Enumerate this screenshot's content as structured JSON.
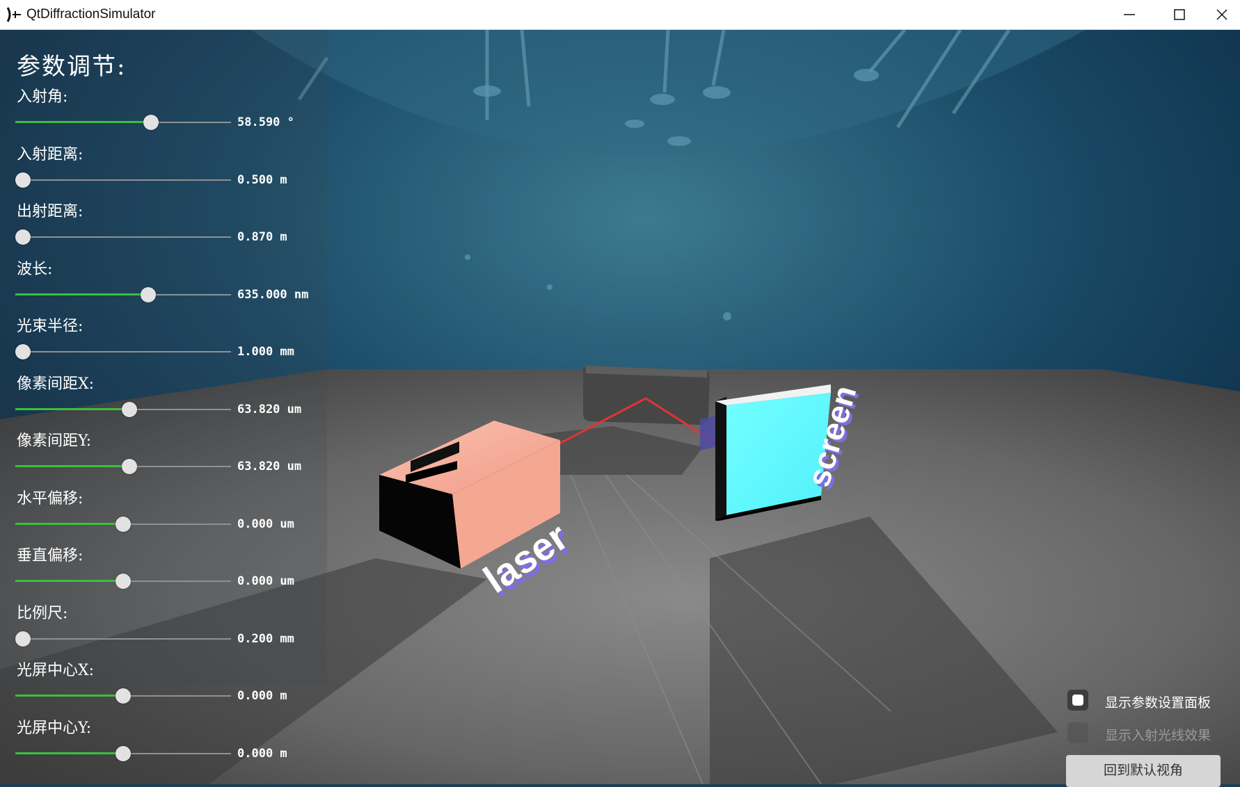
{
  "window": {
    "title": "QtDiffractionSimulator",
    "controls": {
      "minimize": "minimize-icon",
      "maximize": "maximize-icon",
      "close": "close-icon"
    }
  },
  "panel": {
    "title": "参数调节:",
    "params": [
      {
        "label": "入射角:",
        "value": "58.590 °",
        "fraction": 0.64
      },
      {
        "label": "入射距离:",
        "value": "0.500 m",
        "fraction": 0.0
      },
      {
        "label": "出射距离:",
        "value": "0.870 m",
        "fraction": 0.0
      },
      {
        "label": "波长:",
        "value": "635.000 nm",
        "fraction": 0.625
      },
      {
        "label": "光束半径:",
        "value": "1.000 mm",
        "fraction": 0.0
      },
      {
        "label": "像素间距X:",
        "value": "63.820 um",
        "fraction": 0.53
      },
      {
        "label": "像素间距Y:",
        "value": "63.820 um",
        "fraction": 0.53
      },
      {
        "label": "水平偏移:",
        "value": "0.000 um",
        "fraction": 0.5
      },
      {
        "label": "垂直偏移:",
        "value": "0.000 um",
        "fraction": 0.5
      },
      {
        "label": "比例尺:",
        "value": "0.200 mm",
        "fraction": 0.0
      },
      {
        "label": "光屏中心X:",
        "value": "0.000 m",
        "fraction": 0.5
      },
      {
        "label": "光屏中心Y:",
        "value": "0.000 m",
        "fraction": 0.5
      }
    ]
  },
  "scene": {
    "laser_label": "laser",
    "screen_label": "screen",
    "colors": {
      "laser_body": "#f7ac98",
      "screen": "#66fcff",
      "beam": "#e23434",
      "label": "#ffffff",
      "label_side": "#7d6fe0"
    }
  },
  "controls": {
    "show_panel_label": "显示参数设置面板",
    "show_panel_checked": true,
    "show_ray_label": "显示入射光线效果",
    "show_ray_checked": false,
    "reset_view_label": "回到默认视角"
  },
  "colors": {
    "accent": "#3cbf3c",
    "sky": "#103450",
    "floor": "#6d6d6d"
  }
}
